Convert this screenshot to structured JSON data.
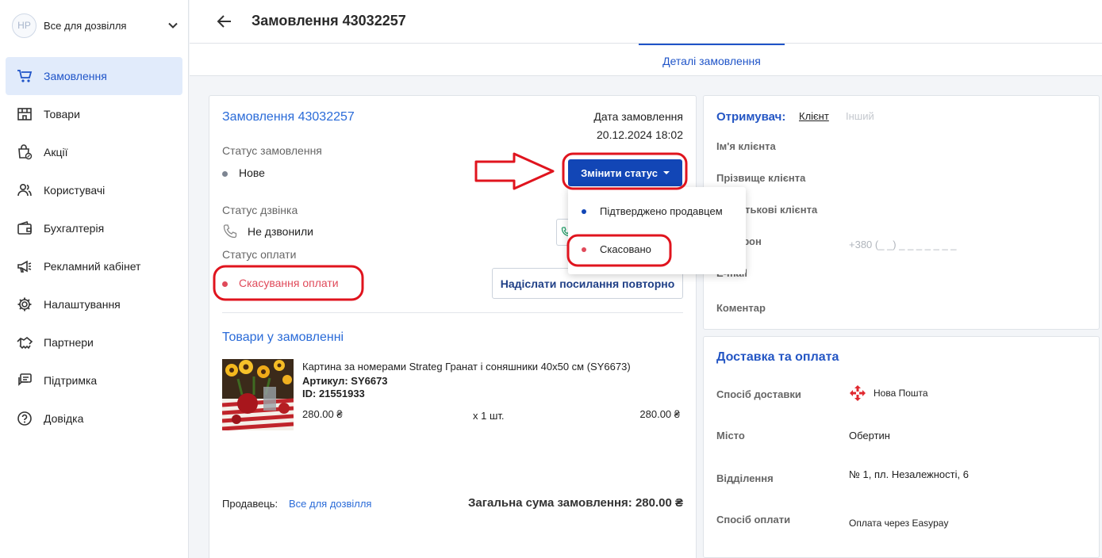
{
  "sidebar": {
    "shop_initials": "НР",
    "shop_name": "Все для дозвілля",
    "items": [
      {
        "label": "Замовлення"
      },
      {
        "label": "Товари"
      },
      {
        "label": "Акції"
      },
      {
        "label": "Користувачі"
      },
      {
        "label": "Бухгалтерія"
      },
      {
        "label": "Рекламний кабінет"
      },
      {
        "label": "Налаштування"
      },
      {
        "label": "Партнери"
      },
      {
        "label": "Підтримка"
      },
      {
        "label": "Довідка"
      }
    ]
  },
  "header": {
    "title": "Замовлення 43032257"
  },
  "tabs": {
    "details": "Деталі замовлення"
  },
  "order": {
    "title": "Замовлення 43032257",
    "date_label": "Дата замовлення",
    "date_value": "20.12.2024 18:02",
    "status_label": "Статус замовлення",
    "status_value": "Нове",
    "change_status_button": "Змінити статус",
    "call_status_label": "Статус дзвінка",
    "call_status_value": "Не дзвонили",
    "payment_status_label": "Статус оплати",
    "payment_status_value": "Скасування оплати",
    "resend_button": "Надіслати посилання повторно"
  },
  "status_menu": {
    "options": [
      {
        "label": "Підтверджено продавцем",
        "color": "#1246b6"
      },
      {
        "label": "Скасовано",
        "color": "#e04a5a"
      }
    ]
  },
  "products": {
    "title": "Товари у замовленні",
    "items": [
      {
        "name": "Картина за номерами Strateg Гранат і соняшники 40х50 см (SY6673)",
        "sku": "Артикул: SY6673",
        "id": "ID: 21551933",
        "price": "280.00 ₴",
        "qty": "х 1 шт.",
        "total": "280.00 ₴"
      }
    ],
    "seller_label": "Продавець:",
    "seller_name": "Все для дозвілля",
    "order_total": "Загальна сума замовлення: 280.00 ₴"
  },
  "recipient": {
    "title": "Отримувач:",
    "tab_client": "Клієнт",
    "tab_other": "Інший",
    "first_name_label": "Ім'я клієнта",
    "last_name_label": "Прізвище клієнта",
    "middle_name_label": "По батькові клієнта",
    "phone_label": "Телефон",
    "phone_value": "+380 (_ _)  _ _ _  _ _  _ _",
    "email_label": "E-mail",
    "comment_label": "Коментар"
  },
  "delivery": {
    "title": "Доставка та оплата",
    "method_label": "Спосіб доставки",
    "method_value": "Нова Пошта",
    "city_label": "Місто",
    "city_value": "Обертин",
    "branch_label": "Відділення",
    "branch_value": "№ 1, пл. Незалежності, 6",
    "payment_label": "Спосіб оплати",
    "payment_value": "Оплата через Easypay"
  },
  "colors": {
    "accent": "#1f54c8",
    "button": "#1246b6",
    "cancel_red": "#e04a5a",
    "annotation_red": "#e0141e"
  }
}
